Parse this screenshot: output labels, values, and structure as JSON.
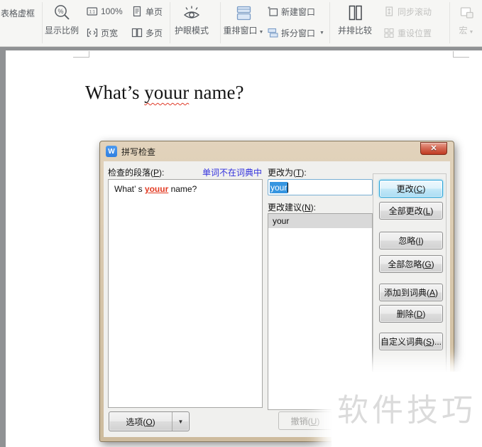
{
  "toolbar": {
    "table_frame_label": "表格虚框",
    "zoom_ratio_label": "显示比例",
    "zoom_value_label": "100%",
    "page_width_label": "页宽",
    "single_page_label": "单页",
    "multi_page_label": "多页",
    "eye_mode_label": "护眼模式",
    "rearrange_label": "重排窗口",
    "new_window_label": "新建窗口",
    "split_window_label": "拆分窗口",
    "side_by_side_label": "并排比较",
    "sync_scroll_label": "同步滚动",
    "reset_position_label": "重设位置",
    "macro_label": "宏"
  },
  "document": {
    "text_before": "What’s ",
    "misspelled_word": "youur",
    "text_after": " name?"
  },
  "dialog": {
    "title": "拼写检查",
    "close_glyph": "✕",
    "paragraph_label": {
      "pre": "检查的段落(",
      "key": "P",
      "post": "):"
    },
    "status_hint": "单词不在词典中",
    "change_to_label": {
      "pre": "更改为(",
      "key": "T",
      "post": "):"
    },
    "suggest_label": {
      "pre": "更改建议(",
      "key": "N",
      "post": "):"
    },
    "preview": {
      "before": "What’ s ",
      "misspelled": "youur",
      "after": " name?"
    },
    "input_value": "your",
    "suggestions": [
      "your"
    ],
    "buttons": [
      {
        "pre": "更改(",
        "key": "C",
        "post": ")"
      },
      {
        "pre": "全部更改(",
        "key": "L",
        "post": ")"
      },
      {
        "pre": "忽略(",
        "key": "I",
        "post": ")"
      },
      {
        "pre": "全部忽略(",
        "key": "G",
        "post": ")"
      },
      {
        "pre": "添加到词典(",
        "key": "A",
        "post": ")"
      },
      {
        "pre": "删除(",
        "key": "D",
        "post": ")"
      },
      {
        "pre": "自定义词典(",
        "key": "S",
        "post": ")..."
      }
    ],
    "options_button": {
      "pre": "选项(",
      "key": "O",
      "post": ")"
    },
    "undo_button": {
      "pre": "撤销(",
      "key": "U",
      "post": ")"
    }
  },
  "watermark_text": "软件技巧",
  "colors": {
    "titlebar_tan": "#d5c4a8",
    "status_blue": "#3230dd",
    "error_red": "#e03a28",
    "selection_blue": "#3595e0",
    "default_button_border": "#27a2d8",
    "watermark_gray": "#dbdbdb"
  }
}
